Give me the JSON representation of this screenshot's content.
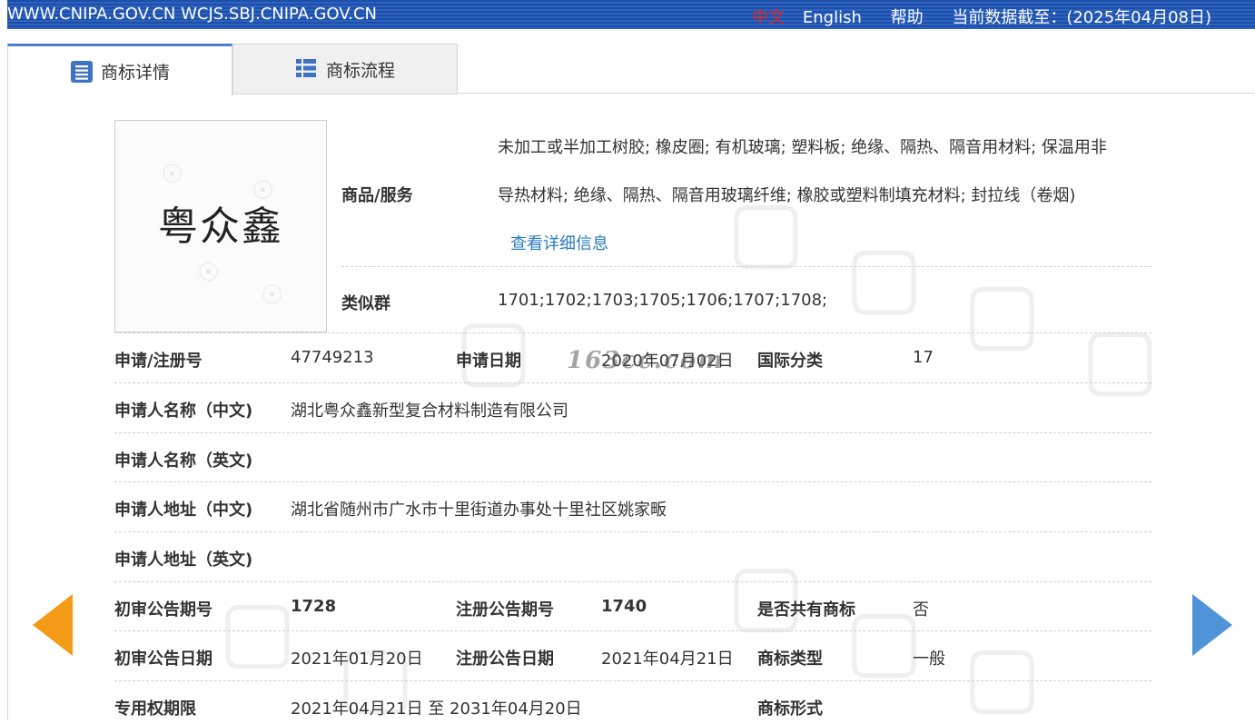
{
  "topbar": {
    "sites": "WWW.CNIPA.GOV.CN WCJS.SBJ.CNIPA.GOV.CN",
    "lang_cn": "中文",
    "lang_en": "English",
    "help": "帮助",
    "data_cutoff": "当前数据截至：(2025年04月08日)"
  },
  "tabs": [
    {
      "label": "商标详情",
      "icon": "document-list-icon",
      "active": true
    },
    {
      "label": "商标流程",
      "icon": "list-icon",
      "active": false
    }
  ],
  "trademark_image": {
    "text": "粤众鑫"
  },
  "goods": {
    "label": "商品/服务",
    "line1": "未加工或半加工树胶; 橡皮圈; 有机玻璃; 塑料板; 绝缘、隔热、隔音用材料; 保温用非",
    "line2": "导热材料; 绝缘、隔热、隔音用玻璃纤维; 橡胶或塑料制填充材料; 封拉线（卷烟)",
    "detail_link": "查看详细信息"
  },
  "similar_group": {
    "label": "类似群",
    "value": "1701;1702;1703;1705;1706;1707;1708;"
  },
  "watermark_text": "163cc.com",
  "rows": {
    "reg_no_label": "申请/注册号",
    "reg_no": "47749213",
    "app_date_label": "申请日期",
    "app_date": "2020年07月02日",
    "intl_class_label": "国际分类",
    "intl_class": "17",
    "applicant_cn_label": "申请人名称（中文)",
    "applicant_cn": "湖北粤众鑫新型复合材料制造有限公司",
    "applicant_en_label": "申请人名称（英文)",
    "applicant_en": "",
    "address_cn_label": "申请人地址（中文)",
    "address_cn": "湖北省随州市广水市十里街道办事处十里社区姚家畈",
    "address_en_label": "申请人地址（英文)",
    "address_en": "",
    "prelim_no_label": "初审公告期号",
    "prelim_no": "1728",
    "reg_ann_no_label": "注册公告期号",
    "reg_ann_no": "1740",
    "shared_label": "是否共有商标",
    "shared": "否",
    "prelim_date_label": "初审公告日期",
    "prelim_date": "2021年01月20日",
    "reg_ann_date_label": "注册公告日期",
    "reg_ann_date": "2021年04月21日",
    "tm_type_label": "商标类型",
    "tm_type": "一般",
    "exclusive_label": "专用权期限",
    "exclusive": "2021年04月21日 至 2031年04月20日",
    "tm_form_label": "商标形式",
    "tm_form": ""
  },
  "colors": {
    "topbar": "#1e4fa8",
    "link": "#2a7bbf",
    "arrow_left": "#f39a17",
    "arrow_right": "#4f93d8",
    "lang_active": "#e0241c"
  }
}
